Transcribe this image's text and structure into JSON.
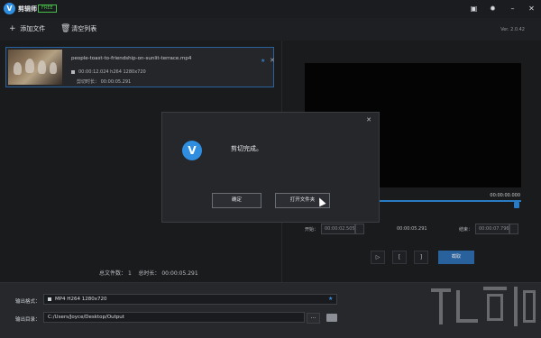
{
  "app": {
    "title": "剪辑师",
    "badge": "FREE",
    "version": "Ver. 2.0.42"
  },
  "titlebar": {
    "icons": [
      "window-icon",
      "gear-icon",
      "minimize-icon",
      "close-icon"
    ]
  },
  "toolbar": {
    "add_label": "添加文件",
    "clear_label": "清空列表"
  },
  "file": {
    "name": "people-toast-to-friendship-on-sunlit-terrace.mp4",
    "info": "00:00:12.024 h264 1280x720",
    "cut_label": "剪切时长：",
    "cut_value": "00:00:05.291"
  },
  "stats": {
    "count_label": "总文件数：",
    "count_value": "1",
    "duration_label": "总时长：",
    "duration_value": "00:00:05.291"
  },
  "player": {
    "current_time": "00:00:00.000",
    "start_label": "开始：",
    "start_value": "00:00:02.505",
    "mid_value": "00:00:05.291",
    "end_label": "结束：",
    "end_value": "00:00:07.796",
    "main_button": "截取",
    "progress": 0.95
  },
  "output": {
    "format_label": "输出格式：",
    "format_value": "MP4 H264 1280x720",
    "path_label": "输出目录：",
    "path_value": "C:/Users/Joyce/Desktop/Output",
    "dots": "..."
  },
  "dialog": {
    "message": "剪切完成。",
    "ok_label": "确定",
    "open_folder_label": "打开文件夹"
  }
}
